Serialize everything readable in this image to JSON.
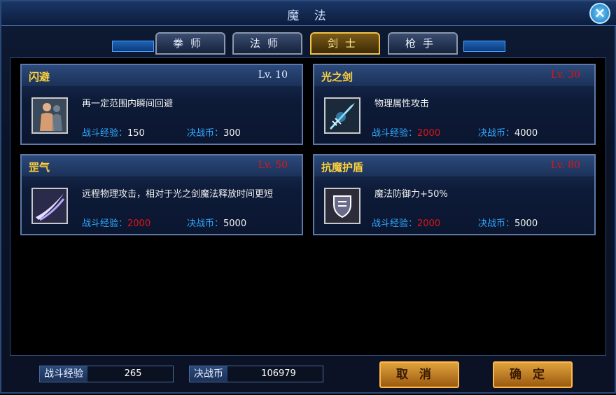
{
  "window": {
    "title": "魔 法"
  },
  "tabs": [
    {
      "label": "拳师",
      "active": false
    },
    {
      "label": "法师",
      "active": false
    },
    {
      "label": "剑士",
      "active": true
    },
    {
      "label": "枪手",
      "active": false
    }
  ],
  "cost_labels": {
    "exp": "战斗经验：",
    "coin": "决战币："
  },
  "skills": [
    {
      "name": "闪避",
      "level": "Lv. 10",
      "level_met": true,
      "icon": "body-figure-icon",
      "desc": "再一定范围内瞬间回避",
      "exp": "150",
      "exp_met": true,
      "coin": "300"
    },
    {
      "name": "光之剑",
      "level": "Lv. 30",
      "level_met": false,
      "icon": "light-sword-icon",
      "desc": "物理属性攻击",
      "exp": "2000",
      "exp_met": false,
      "coin": "4000"
    },
    {
      "name": "罡气",
      "level": "Lv. 50",
      "level_met": false,
      "icon": "slash-icon",
      "desc": "远程物理攻击，相对于光之剑魔法释放时间更短",
      "exp": "2000",
      "exp_met": false,
      "coin": "5000"
    },
    {
      "name": "抗魔护盾",
      "level": "Lv. 80",
      "level_met": false,
      "icon": "shield-icon",
      "desc": "魔法防御力+50%",
      "exp": "2000",
      "exp_met": false,
      "coin": "5000"
    }
  ],
  "footer": {
    "exp_label": "战斗经验",
    "exp_value": "265",
    "coin_label": "决战币",
    "coin_value": "106979",
    "cancel_label": "取消",
    "confirm_label": "确定"
  },
  "colors": {
    "accent_gold": "#ffd33a",
    "unmet_red": "#e01414",
    "label_blue": "#2fa8ff"
  }
}
